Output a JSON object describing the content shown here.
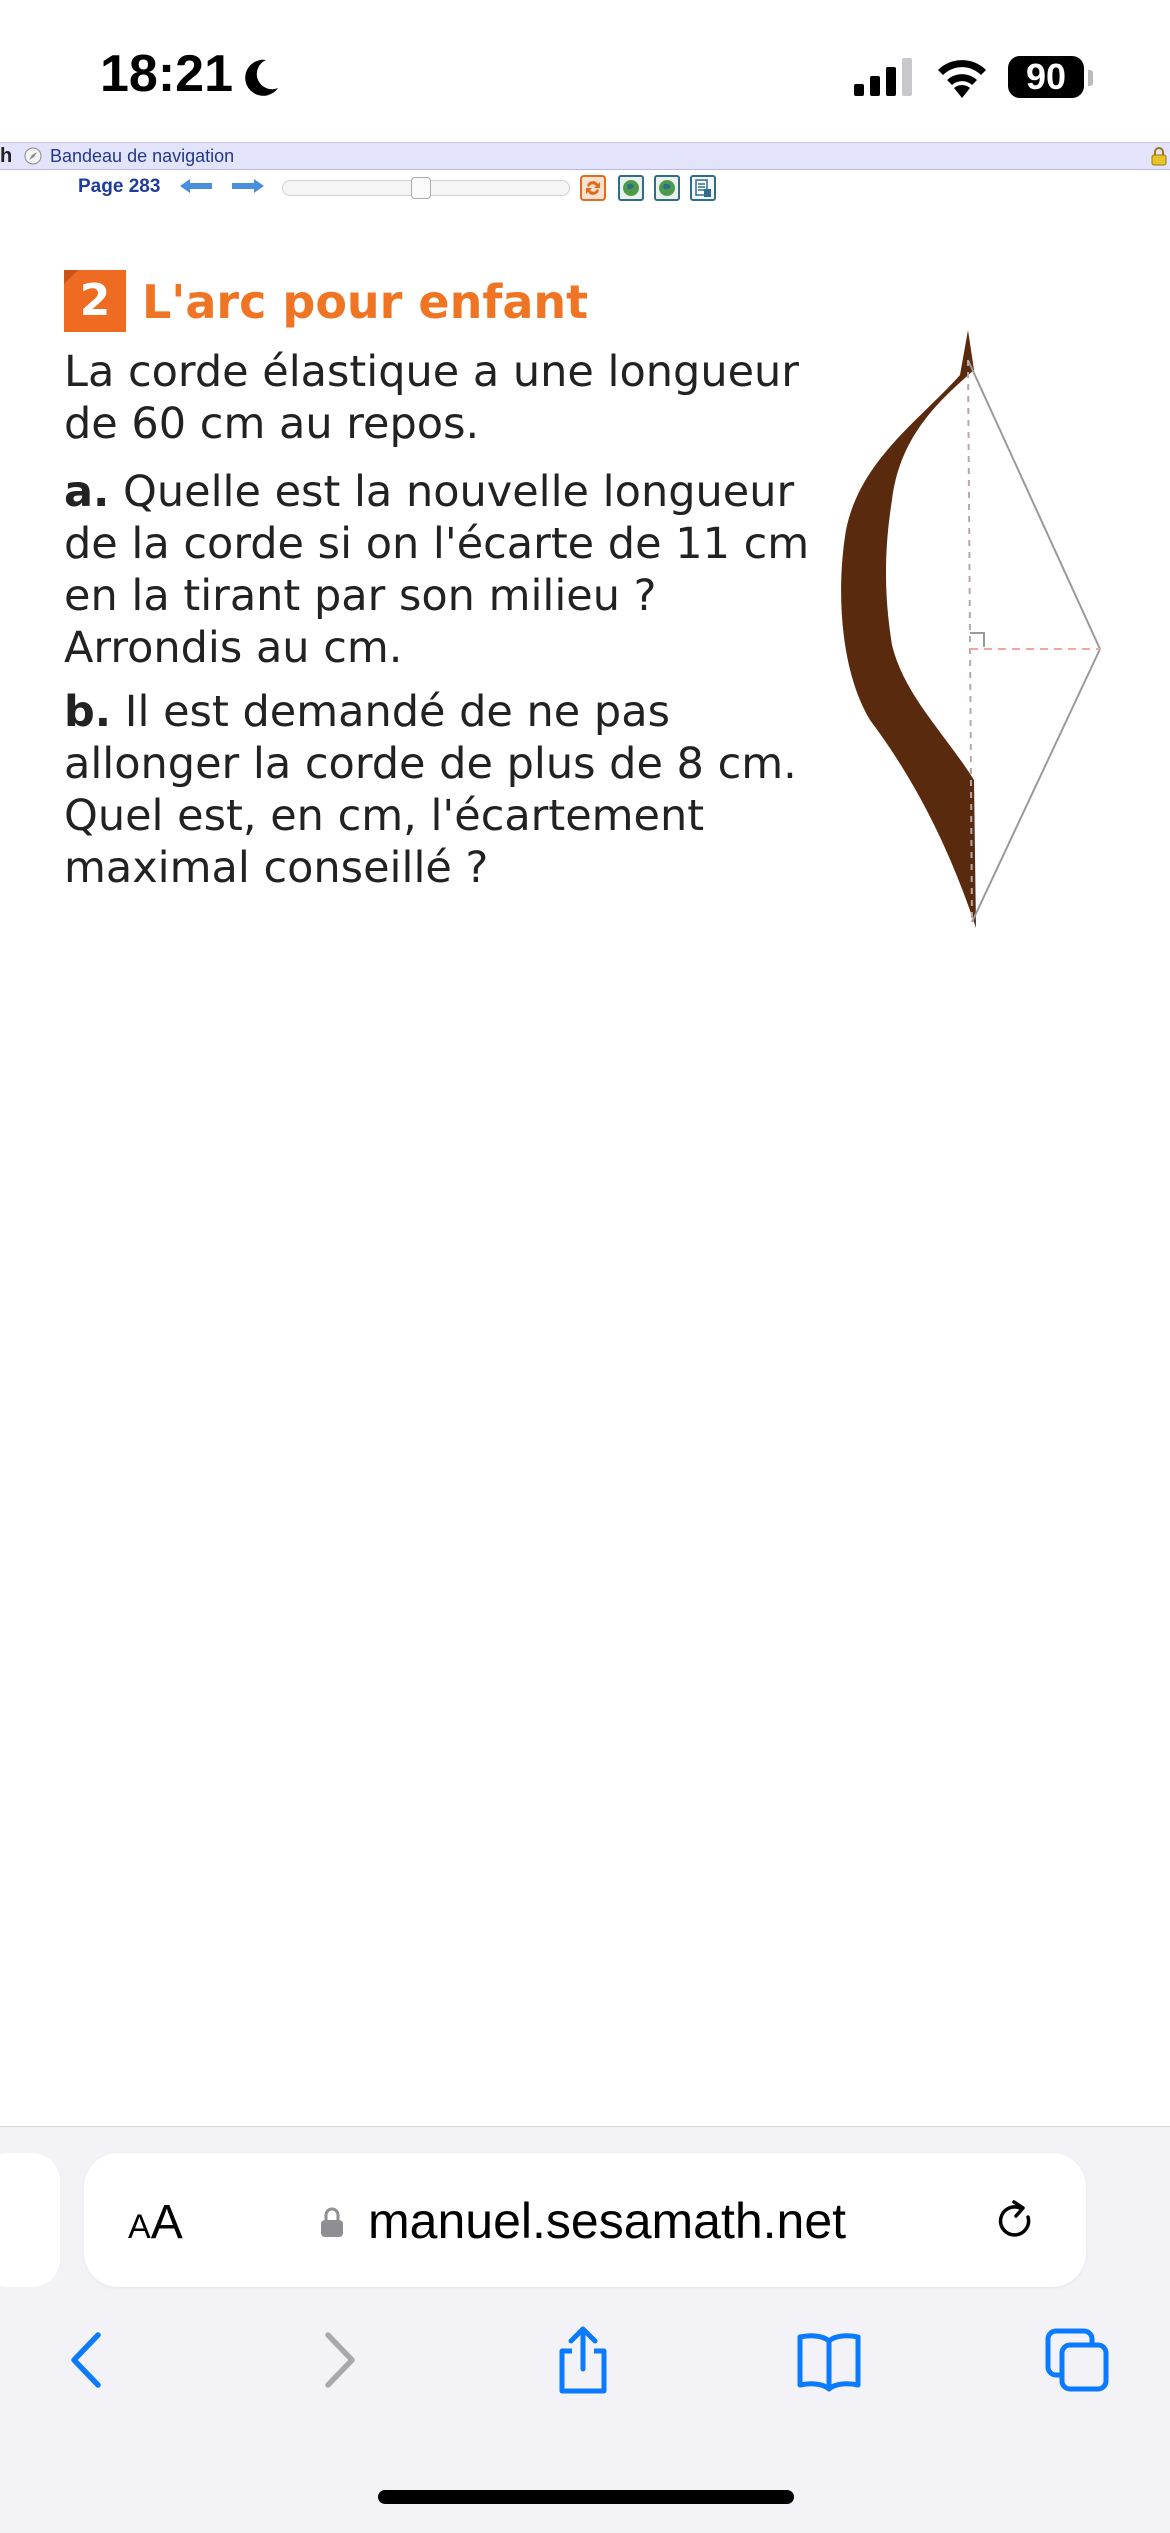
{
  "status_bar": {
    "time": "18:21",
    "battery": "90"
  },
  "nav_strip": {
    "edge_letter": "h",
    "title": "Bandeau de navigation"
  },
  "page_toolbar": {
    "page_label": "Page 283"
  },
  "exercise": {
    "number": "2",
    "title": "L'arc pour enfant",
    "intro": "La corde élastique a une longueur de 60 cm au repos.",
    "part_a_label": "a.",
    "part_a_text": " Quelle est la nouvelle longueur de la corde si on l'écarte de 11 cm en la tirant par son milieu ? Arrondis au cm.",
    "part_b_label": "b.",
    "part_b_text": " Il est demandé de ne pas allonger la corde de plus de 8 cm. Quel est, en cm, l'écartement maximal conseillé ?"
  },
  "browser": {
    "aa_small": "A",
    "aa_big": "A",
    "url": "manuel.sesamath.net"
  },
  "colors": {
    "accent_orange": "#ef7423",
    "nav_blue": "#1f3d9a",
    "ios_blue": "#0a7aff",
    "bow_brown": "#5a2a0f"
  }
}
